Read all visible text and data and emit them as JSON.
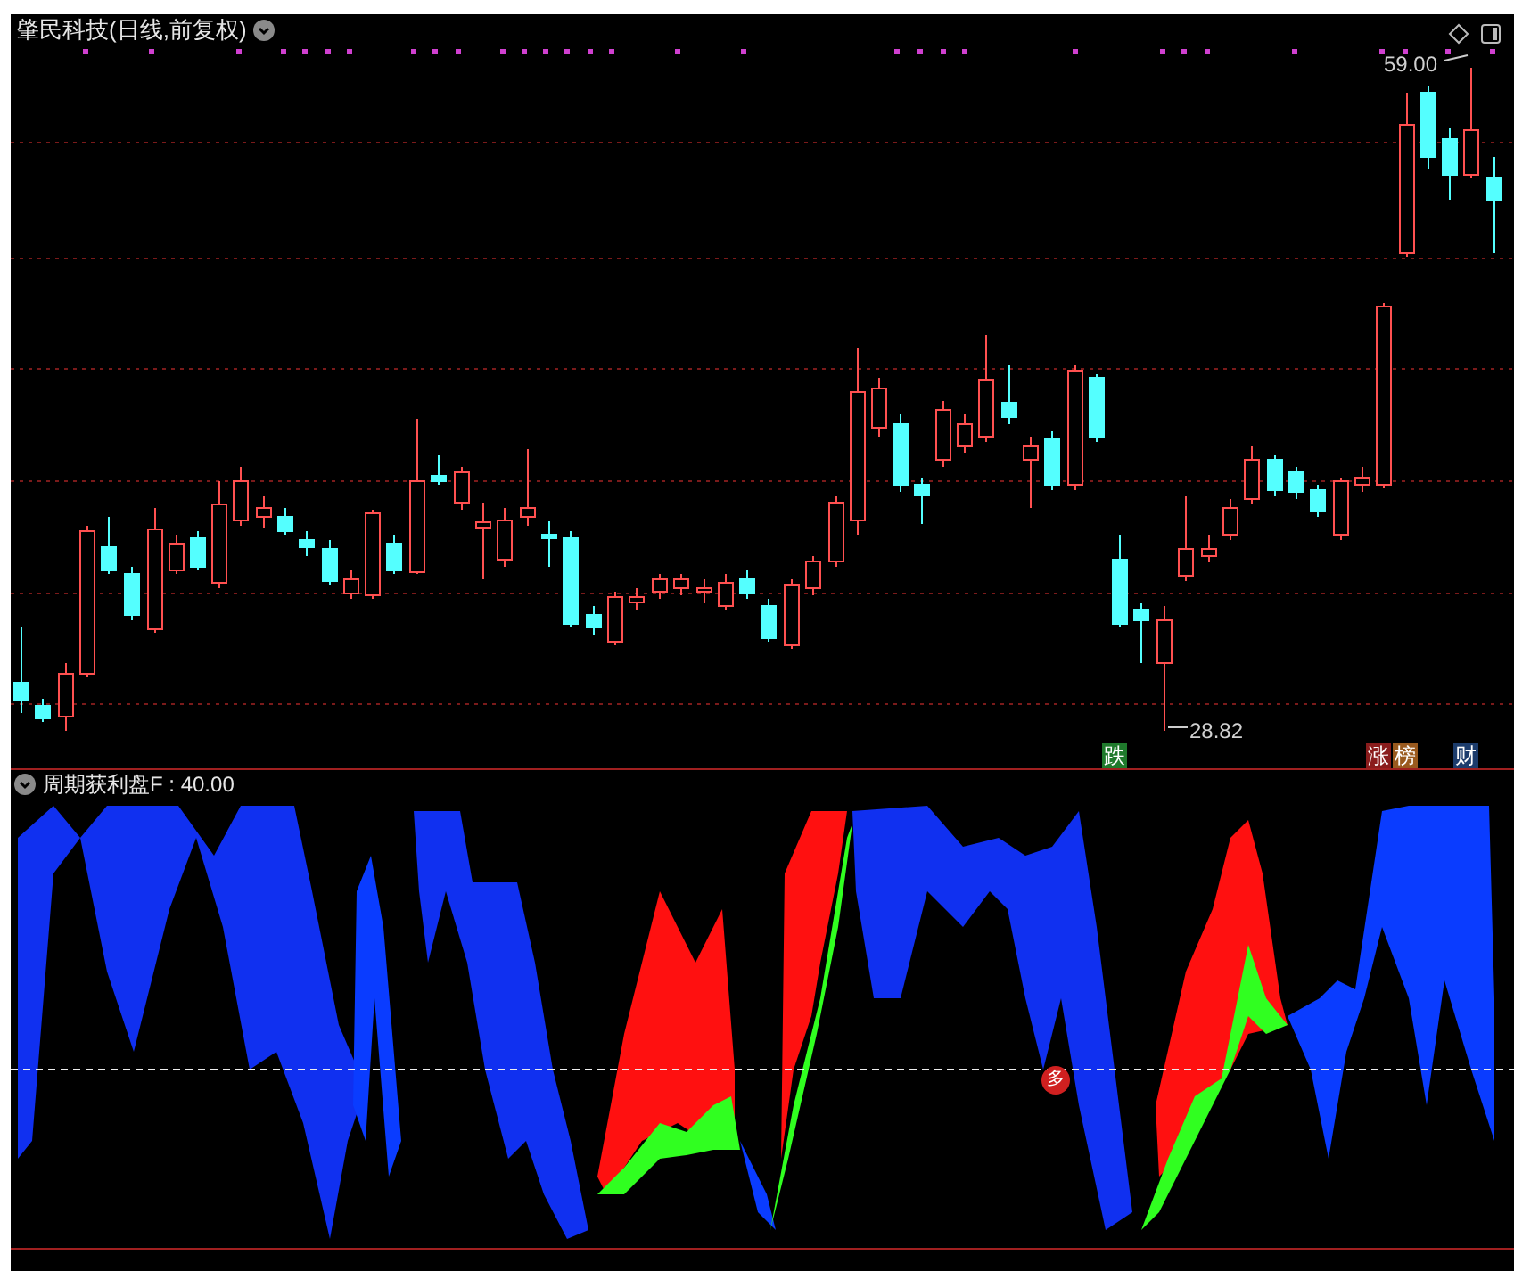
{
  "price_panel": {
    "title": "肇民科技(日线,前复权)",
    "high_label": "59.00",
    "low_label": "28.82",
    "badges": [
      {
        "text": "跌",
        "color": "#1f7a2c"
      },
      {
        "text": "涨",
        "color": "#8a1c1c"
      },
      {
        "text": "榜",
        "color": "#9a5a1e"
      },
      {
        "text": "财",
        "color": "#1c3c6c"
      }
    ]
  },
  "indicator_panel": {
    "title": "周期获利盘F : 40.00",
    "marker": "多"
  }
}
